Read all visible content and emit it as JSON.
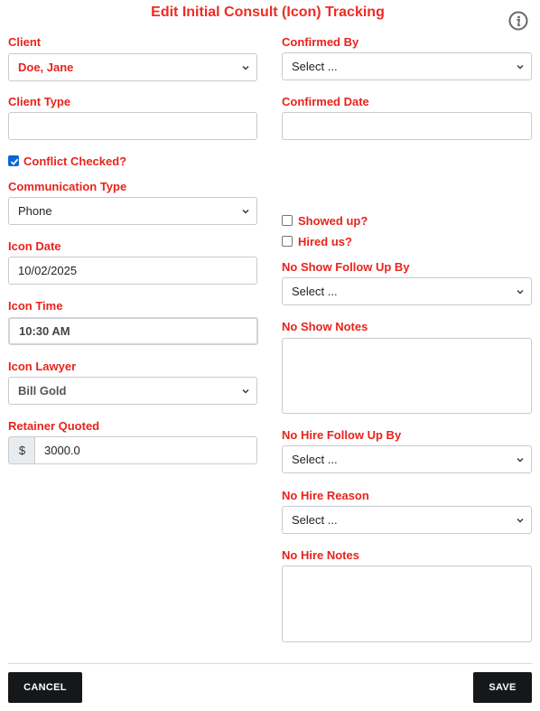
{
  "header": {
    "title": "Edit Initial Consult (Icon) Tracking",
    "info_icon": "info-circle-icon"
  },
  "left": {
    "client_label": "Client",
    "client_value": "Doe, Jane",
    "client_type_label": "Client Type",
    "client_type_value": "",
    "conflict_checked_label": "Conflict Checked?",
    "conflict_checked": true,
    "communication_type_label": "Communication Type",
    "communication_type_value": "Phone",
    "icon_date_label": "Icon Date",
    "icon_date_value": "10/02/2025",
    "icon_time_label": "Icon Time",
    "icon_time_value": "10:30 AM",
    "icon_lawyer_label": "Icon Lawyer",
    "icon_lawyer_value": "Bill Gold",
    "retainer_label": "Retainer Quoted",
    "retainer_prefix": "$",
    "retainer_value": "3000.0"
  },
  "right": {
    "confirmed_by_label": "Confirmed By",
    "confirmed_by_value": "Select ...",
    "confirmed_date_label": "Confirmed Date",
    "confirmed_date_value": "",
    "showed_up_label": "Showed up?",
    "showed_up": false,
    "hired_us_label": "Hired us?",
    "hired_us": false,
    "no_show_follow_up_label": "No Show Follow Up By",
    "no_show_follow_up_value": "Select ...",
    "no_show_notes_label": "No Show Notes",
    "no_hire_follow_up_label": "No Hire Follow Up By",
    "no_hire_follow_up_value": "Select ...",
    "no_hire_reason_label": "No Hire Reason",
    "no_hire_reason_value": "Select ...",
    "no_hire_notes_label": "No Hire Notes"
  },
  "footer": {
    "cancel_label": "CANCEL",
    "save_label": "SAVE"
  },
  "colors": {
    "label": "#e8231b",
    "title": "#ee2b23",
    "button": "#151719",
    "checkbox": "#0b66d8"
  }
}
